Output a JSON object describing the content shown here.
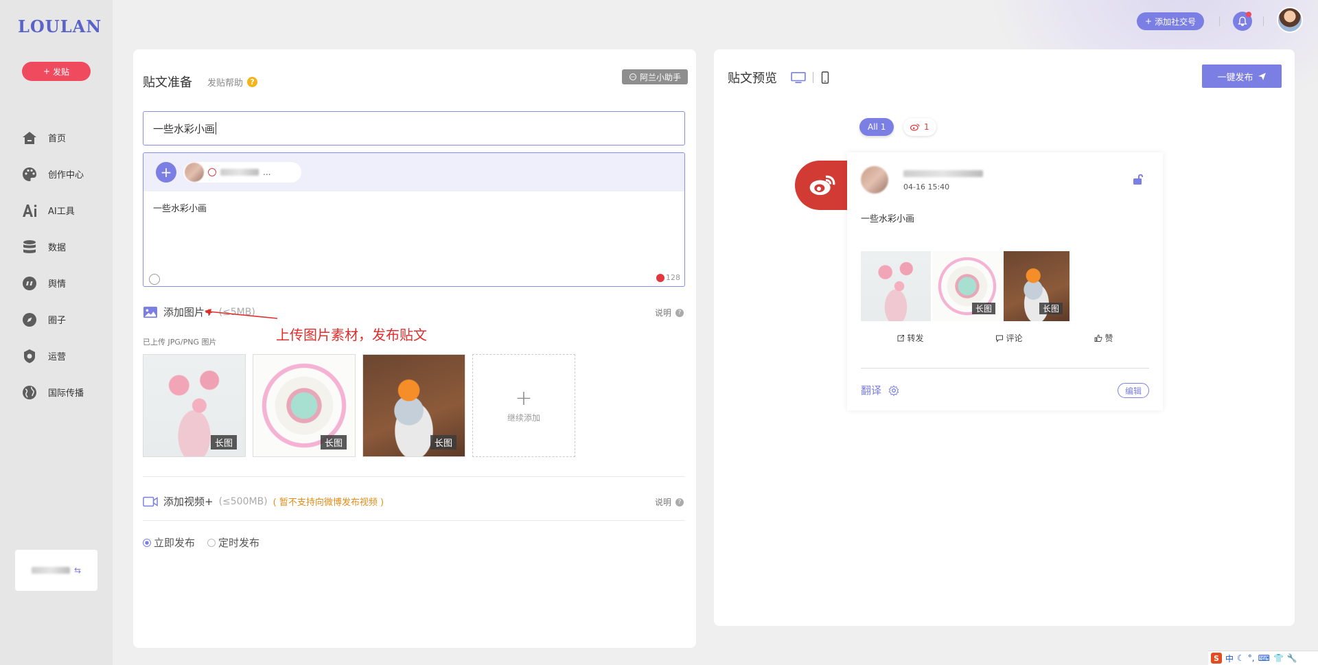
{
  "sidebar": {
    "logo": "LOULAN",
    "post_button": "发贴",
    "items": [
      {
        "label": "首页",
        "icon": "home-icon"
      },
      {
        "label": "创作中心",
        "icon": "palette-icon"
      },
      {
        "label": "AI工具",
        "icon": "ai-icon"
      },
      {
        "label": "数据",
        "icon": "database-icon"
      },
      {
        "label": "舆情",
        "icon": "quote-icon"
      },
      {
        "label": "圈子",
        "icon": "compass-icon"
      },
      {
        "label": "运营",
        "icon": "operations-icon"
      },
      {
        "label": "国际传播",
        "icon": "globe-icon"
      }
    ]
  },
  "topbar": {
    "add_social_label": "添加社交号"
  },
  "compose": {
    "title": "贴文准备",
    "help_label": "发贴帮助",
    "help_badge": "?",
    "assistant_label": "阿兰小助手",
    "title_value": "一些水彩小画",
    "account_name": "...",
    "body_text": "一些水彩小画",
    "char_count": "128",
    "add_image_label": "添加图片+",
    "image_limit": "(≤5MB)",
    "explain_label": "说明",
    "uploaded_hint": "已上传 JPG/PNG 图片",
    "long_image_tag": "长图",
    "add_more_label": "继续添加",
    "add_video_label": "添加视频+",
    "video_limit": "(≤500MB)",
    "video_warning": "( 暂不支持向微博发布视频 )",
    "publish_now": "立即发布",
    "publish_scheduled": "定时发布"
  },
  "annotation": {
    "text": "上传图片素材，发布贴文"
  },
  "preview": {
    "title": "贴文预览",
    "publish_all_label": "一键发布",
    "tab_all": "All 1",
    "tab_weibo_count": "1",
    "post_time": "04-16 15:40",
    "post_text": "一些水彩小画",
    "long_image_tag": "长图",
    "repost_label": "转发",
    "comment_label": "评论",
    "like_label": "赞",
    "translate_label": "翻译",
    "edit_label": "编辑"
  },
  "tray": {
    "ime_logo": "S",
    "ime_lang": "中"
  },
  "colors": {
    "accent": "#7b7fe3",
    "post_red": "#f04a5f",
    "weibo_red": "#d23a34",
    "warning_orange": "#e58b17"
  }
}
